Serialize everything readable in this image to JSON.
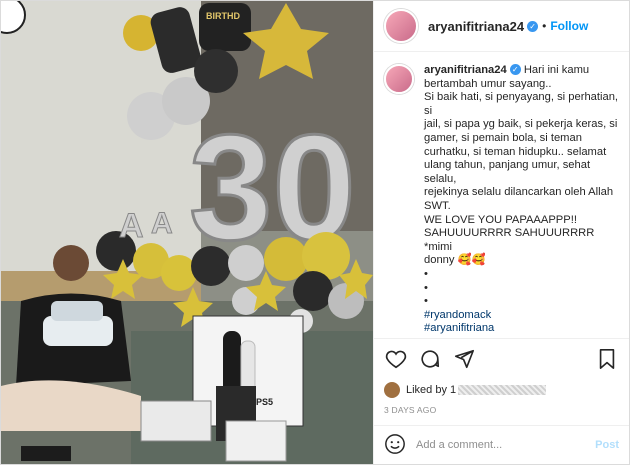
{
  "post": {
    "username": "aryanifitriana24",
    "follow_label": "Follow",
    "dot": "•",
    "caption_lines": [
      "Hari ini kamu",
      "bertambah umur sayang..",
      "Si baik hati, si penyayang, si perhatian, si",
      "jail, si papa yg baik, si pekerja keras, si",
      "gamer, si pemain bola, si teman",
      "curhatku, si teman hidupku.. selamat",
      "ulang tahun, panjang umur, sehat selalu,",
      "rejekinya selalu dilancarkan oleh Allah",
      "SWT.",
      "WE LOVE YOU PAPAAAPPP!!",
      "SAHUUUURRRR SAHUUURRRR *mimi",
      "donny 🥰🥰",
      "•",
      "•",
      "•"
    ],
    "hashtags": [
      "#ryandomack",
      "#aryanifitriana"
    ],
    "time_short": "3d",
    "liked_by": "Liked by",
    "liked_suffix": "1",
    "posted_ago": "3 DAYS AGO",
    "comment_placeholder": "Add a comment...",
    "post_button": "Post"
  },
  "photo": {
    "number_label": "30",
    "box_label": "PS5",
    "balloon_top": "BIRTHD"
  },
  "colors": {
    "accent": "#0095f6",
    "link": "#00376b",
    "muted": "#8e8e8e"
  }
}
